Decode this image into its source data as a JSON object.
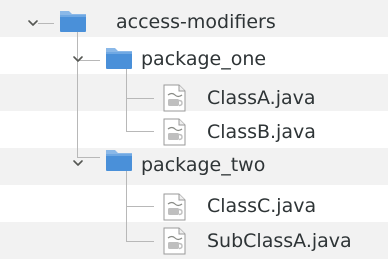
{
  "tree": {
    "nodes": [
      {
        "label": "access-modifiers",
        "kind": "project",
        "icon": "folder-icon",
        "expanded": true,
        "depth": 0
      },
      {
        "label": "package_one",
        "kind": "package",
        "icon": "folder-icon",
        "expanded": true,
        "depth": 1
      },
      {
        "label": "ClassA.java",
        "kind": "file",
        "icon": "java-file-icon",
        "depth": 2
      },
      {
        "label": "ClassB.java",
        "kind": "file",
        "icon": "java-file-icon",
        "depth": 2
      },
      {
        "label": "package_two",
        "kind": "package",
        "icon": "folder-icon",
        "expanded": true,
        "depth": 1
      },
      {
        "label": "ClassC.java",
        "kind": "file",
        "icon": "java-file-icon",
        "depth": 2
      },
      {
        "label": "SubClassA.java",
        "kind": "file",
        "icon": "java-file-icon",
        "depth": 2
      }
    ]
  },
  "colors": {
    "folder_body": "#4a90d9",
    "folder_tab": "#8ab8e8",
    "text": "#2e3436",
    "guide_line": "#b8b8b8",
    "alt_row": "#f2f2f2"
  }
}
